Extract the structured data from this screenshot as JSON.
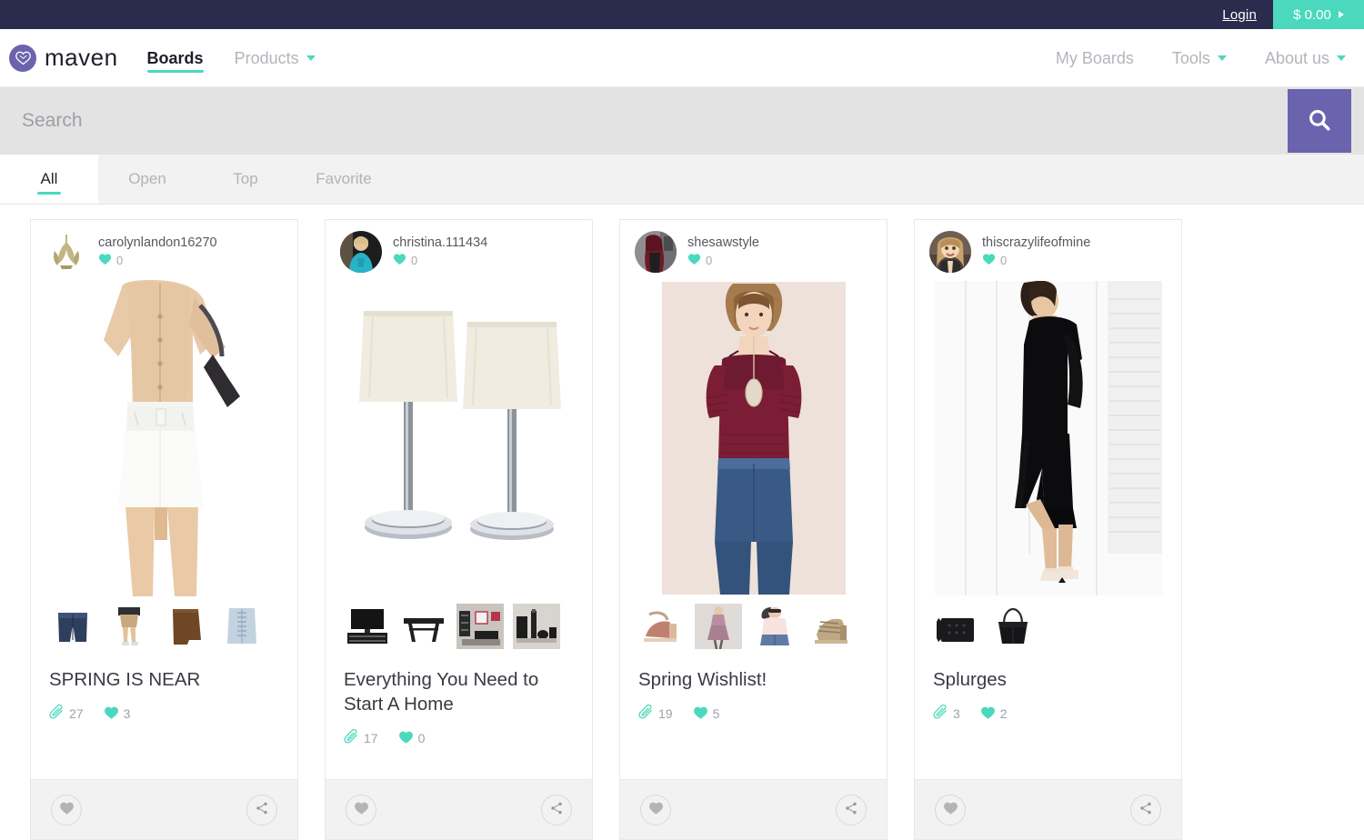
{
  "topbar": {
    "login_label": "Login",
    "cart_amount": "$ 0.00",
    "cart_caret_icon": "caret-right-icon",
    "accent_color": "#4ad9bd",
    "bg_color": "#2b2b4d"
  },
  "navbar": {
    "brand_name": "maven",
    "brand_icon": "heart-infinity-logo-icon",
    "brand_color": "#6b63ad",
    "left_items": [
      {
        "label": "Boards",
        "active": true,
        "has_caret": false
      },
      {
        "label": "Products",
        "active": false,
        "has_caret": true
      }
    ],
    "right_items": [
      {
        "label": "My Boards",
        "active": false,
        "has_caret": false
      },
      {
        "label": "Tools",
        "active": false,
        "has_caret": true
      },
      {
        "label": "About us",
        "active": false,
        "has_caret": true
      }
    ]
  },
  "search": {
    "placeholder": "Search",
    "value": "",
    "button_icon": "search-icon",
    "button_color": "#6b63ad"
  },
  "tabs": [
    {
      "label": "All",
      "active": true
    },
    {
      "label": "Open",
      "active": false
    },
    {
      "label": "Top",
      "active": false
    },
    {
      "label": "Favorite",
      "active": false
    }
  ],
  "cards": [
    {
      "username": "carolynlandon16270",
      "user_likes": "0",
      "avatar_icon": "leaf-avatar-icon",
      "avatar_round": false,
      "hero_icon": "white-skirt-outfit-photo",
      "title": "SPRING IS NEAR",
      "clips": "27",
      "likes": "3",
      "thumbs": [
        "denim-shorts-thumb",
        "khaki-shorts-outfit-thumb",
        "brown-skirt-thumb",
        "light-denim-skirt-thumb"
      ],
      "like_button_icon": "heart-icon",
      "share_button_icon": "share-icon"
    },
    {
      "username": "christina.111434",
      "user_likes": "0",
      "avatar_icon": "woman-teal-top-avatar",
      "avatar_round": true,
      "hero_icon": "two-table-lamps-photo",
      "title": "Everything You Need to Start A Home",
      "clips": "17",
      "likes": "0",
      "thumbs": [
        "tv-stand-thumb",
        "dining-table-thumb",
        "living-room-set-thumb",
        "bath-accessory-set-thumb"
      ],
      "like_button_icon": "heart-icon",
      "share_button_icon": "share-icon"
    },
    {
      "username": "shesawstyle",
      "user_likes": "0",
      "avatar_icon": "red-hair-woman-avatar",
      "avatar_round": true,
      "hero_icon": "burgundy-lace-off-shoulder-top-photo",
      "title": "Spring Wishlist!",
      "clips": "19",
      "likes": "5",
      "thumbs": [
        "block-heel-sandal-thumb",
        "mauve-midi-dress-thumb",
        "blush-top-jeans-thumb",
        "gladiator-heel-thumb"
      ],
      "like_button_icon": "heart-icon",
      "share_button_icon": "share-icon"
    },
    {
      "username": "thiscrazylifeofmine",
      "user_likes": "0",
      "avatar_icon": "blonde-woman-avatar",
      "avatar_round": true,
      "hero_icon": "black-slit-dress-photo",
      "title": "Splurges",
      "clips": "3",
      "likes": "2",
      "thumbs": [
        "black-studded-clutch-thumb",
        "black-tote-bag-thumb"
      ],
      "like_button_icon": "heart-icon",
      "share_button_icon": "share-icon"
    }
  ]
}
